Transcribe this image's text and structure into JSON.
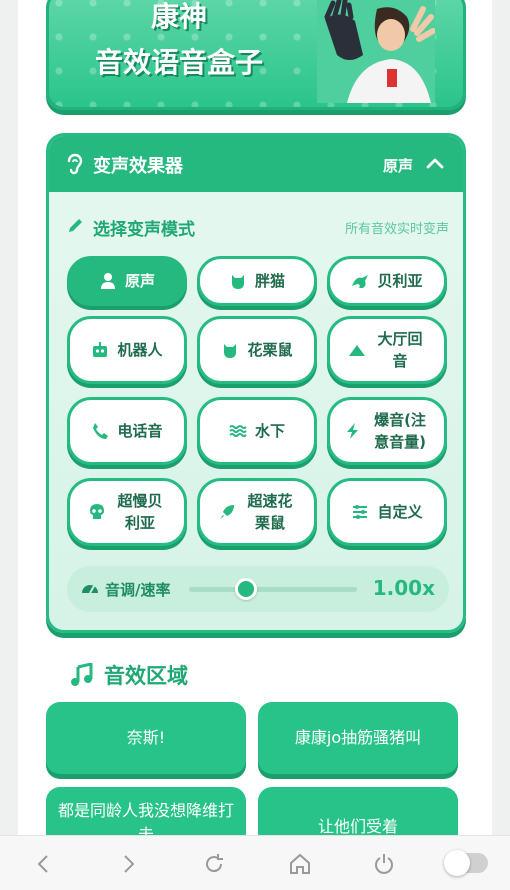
{
  "banner": {
    "line1": "康神",
    "line2": "音效语音盒子"
  },
  "voice_changer": {
    "title": "变声效果器",
    "current_mode": "原声",
    "select_label": "选择变声模式",
    "hint": "所有音效实时变声",
    "modes": [
      {
        "label": "原声",
        "icon": "person-icon",
        "active": true
      },
      {
        "label": "胖猫",
        "icon": "cat-icon"
      },
      {
        "label": "贝利亚",
        "icon": "dragon-icon"
      },
      {
        "label": "机器人",
        "icon": "robot-icon"
      },
      {
        "label": "花栗鼠",
        "icon": "cat-icon"
      },
      {
        "label": "大厅回音",
        "icon": "mountain-icon"
      },
      {
        "label": "电话音",
        "icon": "phone-icon"
      },
      {
        "label": "水下",
        "icon": "water-icon"
      },
      {
        "label": "爆音(注意音量)",
        "icon": "bolt-icon"
      },
      {
        "label": "超慢贝利亚",
        "icon": "skull-icon"
      },
      {
        "label": "超速花栗鼠",
        "icon": "rocket-icon"
      },
      {
        "label": "自定义",
        "icon": "sliders-icon"
      }
    ],
    "pitch": {
      "label": "音调/速率",
      "value": "1.00x",
      "slider_fraction": 0.34
    }
  },
  "sound_area": {
    "title": "音效区域",
    "items": [
      {
        "label": "奈斯!"
      },
      {
        "label": "康康jo抽筋骚猪叫"
      },
      {
        "label": "都是同龄人我没想降维打击"
      },
      {
        "label": "让他们受着"
      }
    ]
  },
  "browser_nav": {
    "icons": [
      "back-icon",
      "forward-icon",
      "reload-icon",
      "home-icon",
      "power-icon",
      "toggle-switch"
    ]
  },
  "colors": {
    "accent": "#25b980",
    "accent_dark": "#1a9f6d",
    "accent_light": "#e6f8f0"
  }
}
